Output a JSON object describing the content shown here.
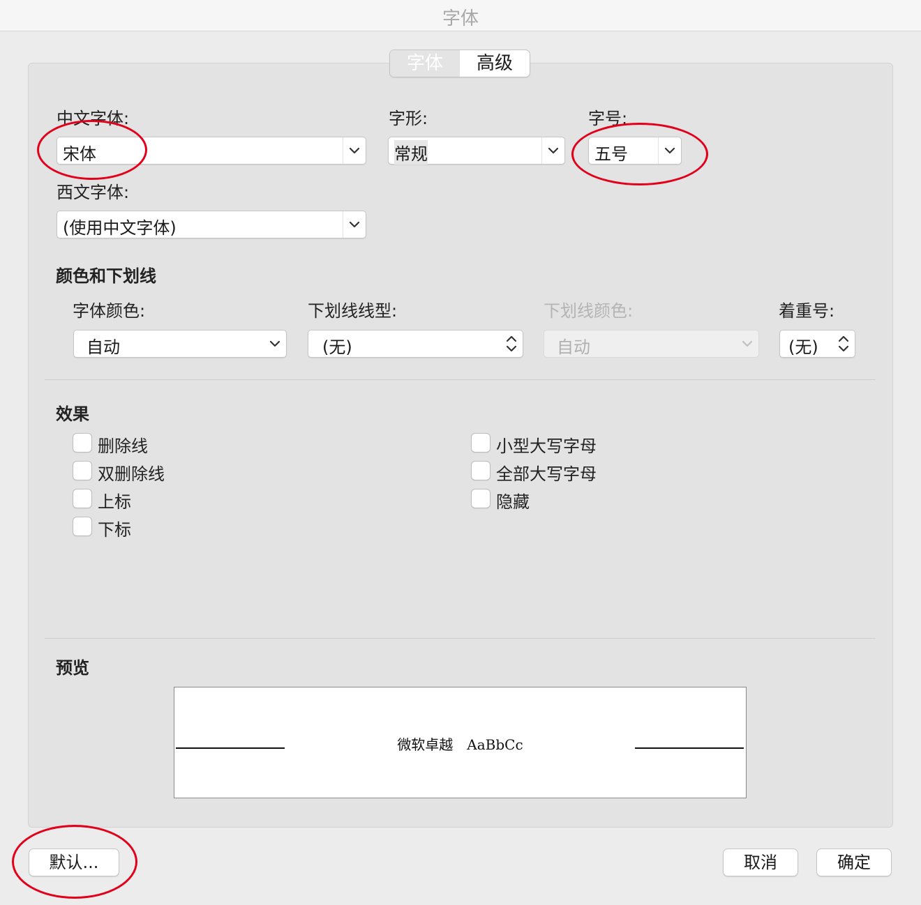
{
  "window": {
    "title": "字体"
  },
  "tabs": [
    {
      "label": "字体",
      "active": true
    },
    {
      "label": "高级",
      "active": false
    }
  ],
  "font": {
    "chinese_label": "中文字体:",
    "chinese_value": "宋体",
    "style_label": "字形:",
    "style_value": "常规",
    "size_label": "字号:",
    "size_value": "五号",
    "western_label": "西文字体:",
    "western_value": "(使用中文字体)"
  },
  "color_section": {
    "title": "颜色和下划线",
    "font_color_label": "字体颜色:",
    "font_color_value": "自动",
    "underline_style_label": "下划线线型:",
    "underline_style_value": "(无)",
    "underline_color_label": "下划线颜色:",
    "underline_color_value": "自动",
    "emphasis_label": "着重号:",
    "emphasis_value": "(无)"
  },
  "effects": {
    "title": "效果",
    "left": [
      "删除线",
      "双删除线",
      "上标",
      "下标"
    ],
    "right": [
      "小型大写字母",
      "全部大写字母",
      "隐藏"
    ]
  },
  "preview": {
    "title": "预览",
    "sample": "微软卓越　AaBbCc"
  },
  "buttons": {
    "default": "默认...",
    "cancel": "取消",
    "ok": "确定"
  },
  "colors": {
    "annotation": "#e3001b",
    "panel": "#e3e3e3",
    "background": "#ececec"
  }
}
